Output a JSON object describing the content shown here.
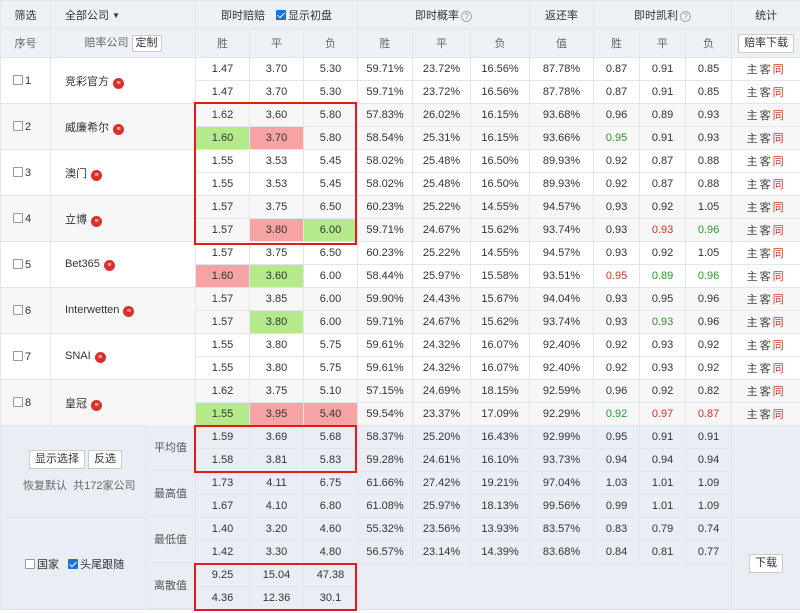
{
  "header": {
    "filter": "筛选",
    "company_select": "全部公司",
    "instant_odds": "即时赔赔",
    "show_initial": "显示初盘",
    "instant_prob": "即时概率",
    "return_rate": "返还率",
    "instant_kelly": "即时凯利",
    "stats": "统计",
    "seq": "序号",
    "odds_company": "赔率公司",
    "customize": "定制",
    "win": "胜",
    "draw": "平",
    "lose": "负",
    "value": "值",
    "download_odds": "赔率下载"
  },
  "companies": [
    {
      "no": "1",
      "name": "竞彩官方",
      "rows": [
        {
          "w": "1.47",
          "d": "3.70",
          "l": "5.30",
          "pw": "59.71%",
          "pd": "23.72%",
          "pl": "16.56%",
          "rr": "87.78%",
          "kw": "0.87",
          "kd": "0.91",
          "kl": "0.85"
        },
        {
          "w": "1.47",
          "d": "3.70",
          "l": "5.30",
          "pw": "59.71%",
          "pd": "23.72%",
          "pl": "16.56%",
          "rr": "87.78%",
          "kw": "0.87",
          "kd": "0.91",
          "kl": "0.85"
        }
      ]
    },
    {
      "no": "2",
      "name": "威廉希尔",
      "rows": [
        {
          "w": "1.62",
          "d": "3.60",
          "l": "5.80",
          "pw": "57.83%",
          "pd": "26.02%",
          "pl": "16.15%",
          "rr": "93.68%",
          "kw": "0.96",
          "kd": "0.89",
          "kl": "0.93"
        },
        {
          "w": "1.60",
          "d": "3.70",
          "l": "5.80",
          "pw": "58.54%",
          "pd": "25.31%",
          "pl": "16.15%",
          "rr": "93.66%",
          "kw": "0.95",
          "kd": "0.91",
          "kl": "0.93"
        }
      ]
    },
    {
      "no": "3",
      "name": "澳门",
      "rows": [
        {
          "w": "1.55",
          "d": "3.53",
          "l": "5.45",
          "pw": "58.02%",
          "pd": "25.48%",
          "pl": "16.50%",
          "rr": "89.93%",
          "kw": "0.92",
          "kd": "0.87",
          "kl": "0.88"
        },
        {
          "w": "1.55",
          "d": "3.53",
          "l": "5.45",
          "pw": "58.02%",
          "pd": "25.48%",
          "pl": "16.50%",
          "rr": "89.93%",
          "kw": "0.92",
          "kd": "0.87",
          "kl": "0.88"
        }
      ]
    },
    {
      "no": "4",
      "name": "立博",
      "rows": [
        {
          "w": "1.57",
          "d": "3.75",
          "l": "6.50",
          "pw": "60.23%",
          "pd": "25.22%",
          "pl": "14.55%",
          "rr": "94.57%",
          "kw": "0.93",
          "kd": "0.92",
          "kl": "1.05"
        },
        {
          "w": "1.57",
          "d": "3.80",
          "l": "6.00",
          "pw": "59.71%",
          "pd": "24.67%",
          "pl": "15.62%",
          "rr": "93.74%",
          "kw": "0.93",
          "kd": "0.93",
          "kl": "0.96"
        }
      ]
    },
    {
      "no": "5",
      "name": "Bet365",
      "rows": [
        {
          "w": "1.57",
          "d": "3.75",
          "l": "6.50",
          "pw": "60.23%",
          "pd": "25.22%",
          "pl": "14.55%",
          "rr": "94.57%",
          "kw": "0.93",
          "kd": "0.92",
          "kl": "1.05"
        },
        {
          "w": "1.60",
          "d": "3.60",
          "l": "6.00",
          "pw": "58.44%",
          "pd": "25.97%",
          "pl": "15.58%",
          "rr": "93.51%",
          "kw": "0.95",
          "kd": "0.89",
          "kl": "0.96"
        }
      ]
    },
    {
      "no": "6",
      "name": "Interwetten",
      "rows": [
        {
          "w": "1.57",
          "d": "3.85",
          "l": "6.00",
          "pw": "59.90%",
          "pd": "24.43%",
          "pl": "15.67%",
          "rr": "94.04%",
          "kw": "0.93",
          "kd": "0.95",
          "kl": "0.96"
        },
        {
          "w": "1.57",
          "d": "3.80",
          "l": "6.00",
          "pw": "59.71%",
          "pd": "24.67%",
          "pl": "15.62%",
          "rr": "93.74%",
          "kw": "0.93",
          "kd": "0.93",
          "kl": "0.96"
        }
      ]
    },
    {
      "no": "7",
      "name": "SNAI",
      "rows": [
        {
          "w": "1.55",
          "d": "3.80",
          "l": "5.75",
          "pw": "59.61%",
          "pd": "24.32%",
          "pl": "16.07%",
          "rr": "92.40%",
          "kw": "0.92",
          "kd": "0.93",
          "kl": "0.92"
        },
        {
          "w": "1.55",
          "d": "3.80",
          "l": "5.75",
          "pw": "59.61%",
          "pd": "24.32%",
          "pl": "16.07%",
          "rr": "92.40%",
          "kw": "0.92",
          "kd": "0.93",
          "kl": "0.92"
        }
      ]
    },
    {
      "no": "8",
      "name": "皇冠",
      "rows": [
        {
          "w": "1.62",
          "d": "3.75",
          "l": "5.10",
          "pw": "57.15%",
          "pd": "24.69%",
          "pl": "18.15%",
          "rr": "92.59%",
          "kw": "0.96",
          "kd": "0.92",
          "kl": "0.82"
        },
        {
          "w": "1.55",
          "d": "3.95",
          "l": "5.40",
          "pw": "59.54%",
          "pd": "23.37%",
          "pl": "17.09%",
          "rr": "92.29%",
          "kw": "0.92",
          "kd": "0.97",
          "kl": "0.87"
        }
      ]
    }
  ],
  "stats": {
    "avg_label": "平均值",
    "max_label": "最高值",
    "min_label": "最低值",
    "var_label": "离散值",
    "avg": [
      {
        "w": "1.59",
        "d": "3.69",
        "l": "5.68",
        "pw": "58.37%",
        "pd": "25.20%",
        "pl": "16.43%",
        "rr": "92.99%",
        "kw": "0.95",
        "kd": "0.91",
        "kl": "0.91"
      },
      {
        "w": "1.58",
        "d": "3.81",
        "l": "5.83",
        "pw": "59.28%",
        "pd": "24.61%",
        "pl": "16.10%",
        "rr": "93.73%",
        "kw": "0.94",
        "kd": "0.94",
        "kl": "0.94"
      }
    ],
    "max": [
      {
        "w": "1.73",
        "d": "4.11",
        "l": "6.75",
        "pw": "61.66%",
        "pd": "27.42%",
        "pl": "19.21%",
        "rr": "97.04%",
        "kw": "1.03",
        "kd": "1.01",
        "kl": "1.09"
      },
      {
        "w": "1.67",
        "d": "4.10",
        "l": "6.80",
        "pw": "61.08%",
        "pd": "25.97%",
        "pl": "18.13%",
        "rr": "99.56%",
        "kw": "0.99",
        "kd": "1.01",
        "kl": "1.09"
      }
    ],
    "min": [
      {
        "w": "1.40",
        "d": "3.20",
        "l": "4.60",
        "pw": "55.32%",
        "pd": "23.56%",
        "pl": "13.93%",
        "rr": "83.57%",
        "kw": "0.83",
        "kd": "0.79",
        "kl": "0.74"
      },
      {
        "w": "1.42",
        "d": "3.30",
        "l": "4.80",
        "pw": "56.57%",
        "pd": "23.14%",
        "pl": "14.39%",
        "rr": "83.68%",
        "kw": "0.84",
        "kd": "0.81",
        "kl": "0.77"
      }
    ],
    "var": [
      {
        "w": "9.25",
        "d": "15.04",
        "l": "47.38"
      },
      {
        "w": "4.36",
        "d": "12.36",
        "l": "30.1"
      }
    ]
  },
  "controls": {
    "show_selected": "显示选择",
    "invert": "反选",
    "restore_default": "恢复默认",
    "total_companies": "共172家公司",
    "country": "国家",
    "head_tail": "头尾跟随",
    "download": "下载"
  },
  "ztk": {
    "z": "主",
    "k": "客",
    "t": "同"
  },
  "colors": {
    "highlight_green": "#b4ea8a",
    "highlight_red": "#f5a3a3",
    "red_box": "#e31b1b",
    "kelly_green": "#2a9a2a",
    "kelly_red": "#d9302b"
  }
}
